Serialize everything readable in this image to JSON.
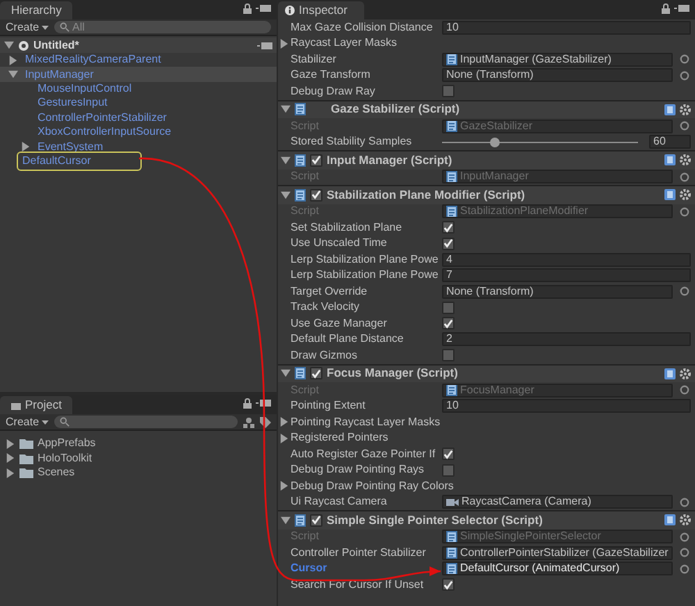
{
  "hierarchy": {
    "title": "Hierarchy",
    "create": "Create",
    "search_placeholder": "All",
    "scene": {
      "name": "Untitled*",
      "expanded": true
    },
    "items": [
      {
        "label": "MixedRealityCameraParent",
        "expanded": false,
        "selected": false,
        "highlighted": false
      },
      {
        "label": "InputManager",
        "expanded": true,
        "selected": true,
        "highlighted": false,
        "children": [
          {
            "label": "MouseInputControl",
            "selected": false,
            "highlighted": false
          },
          {
            "label": "GesturesInput",
            "selected": false,
            "highlighted": false
          },
          {
            "label": "ControllerPointerStabilizer",
            "selected": false,
            "highlighted": false
          },
          {
            "label": "XboxControllerInputSource",
            "selected": false,
            "highlighted": false
          },
          {
            "label": "EventSystem",
            "expanded": false,
            "selected": false,
            "highlighted": false
          }
        ]
      },
      {
        "label": "DefaultCursor",
        "selected": false,
        "highlighted": true
      }
    ]
  },
  "project": {
    "title": "Project",
    "create": "Create",
    "folders": [
      {
        "label": "AppPrefabs",
        "expanded": false
      },
      {
        "label": "HoloToolkit",
        "expanded": false
      },
      {
        "label": "Scenes",
        "expanded": false
      }
    ]
  },
  "inspector": {
    "title": "Inspector",
    "rows": [
      {
        "kind": "number",
        "label": "Max Gaze Collision Distance",
        "value": "10"
      },
      {
        "kind": "foldout",
        "label": "Raycast Layer Masks",
        "expanded": false
      },
      {
        "kind": "object",
        "label": "Stabilizer",
        "value": "InputManager (GazeStabilizer)"
      },
      {
        "kind": "empty_object",
        "label": "Gaze Transform",
        "value": "None (Transform)"
      },
      {
        "kind": "toggle",
        "label": "Debug Draw Ray",
        "checked": false
      }
    ],
    "components": [
      {
        "title": "Gaze Stabilizer (Script)",
        "expanded": true,
        "rows": [
          {
            "kind": "script",
            "label": "Script",
            "value": "GazeStabilizer",
            "disabled": true
          },
          {
            "kind": "slider",
            "label": "Stored Stability Samples",
            "level": 0.27,
            "value": "60"
          }
        ]
      },
      {
        "title": "Input Manager (Script)",
        "expanded": true,
        "enabled": true,
        "rows": [
          {
            "kind": "script",
            "label": "Script",
            "value": "InputManager",
            "disabled": true
          }
        ]
      },
      {
        "title": "Stabilization Plane Modifier (Script)",
        "expanded": true,
        "enabled": true,
        "rows": [
          {
            "kind": "script",
            "label": "Script",
            "value": "StabilizationPlaneModifier",
            "disabled": true
          },
          {
            "kind": "toggle",
            "label": "Set Stabilization Plane",
            "checked": true
          },
          {
            "kind": "toggle",
            "label": "Use Unscaled Time",
            "checked": true
          },
          {
            "kind": "number",
            "label": "Lerp Stabilization Plane Powe",
            "value": "4"
          },
          {
            "kind": "number",
            "label": "Lerp Stabilization Plane Powe",
            "value": "7"
          },
          {
            "kind": "empty_object",
            "label": "Target Override",
            "value": "None (Transform)"
          },
          {
            "kind": "toggle",
            "label": "Track Velocity",
            "checked": false
          },
          {
            "kind": "toggle",
            "label": "Use Gaze Manager",
            "checked": true
          },
          {
            "kind": "number",
            "label": "Default Plane Distance",
            "value": "2"
          },
          {
            "kind": "toggle",
            "label": "Draw Gizmos",
            "checked": false
          }
        ]
      },
      {
        "title": "Focus Manager (Script)",
        "expanded": true,
        "enabled": true,
        "rows": [
          {
            "kind": "script",
            "label": "Script",
            "value": "FocusManager",
            "disabled": true
          },
          {
            "kind": "number",
            "label": "Pointing Extent",
            "value": "10"
          },
          {
            "kind": "foldout",
            "label": "Pointing Raycast Layer Masks",
            "expanded": false
          },
          {
            "kind": "foldout",
            "label": "Registered Pointers",
            "expanded": false
          },
          {
            "kind": "toggle",
            "label": "Auto Register Gaze Pointer If",
            "checked": true
          },
          {
            "kind": "toggle",
            "label": "Debug Draw Pointing Rays",
            "checked": false
          },
          {
            "kind": "foldout",
            "label": "Debug Draw Pointing Ray Colors",
            "expanded": false
          },
          {
            "kind": "camera_object",
            "label": "Ui Raycast Camera",
            "value": "RaycastCamera (Camera)"
          }
        ]
      },
      {
        "title": "Simple Single Pointer Selector (Script)",
        "expanded": true,
        "enabled": true,
        "rows": [
          {
            "kind": "script",
            "label": "Script",
            "value": "SimpleSinglePointerSelector",
            "disabled": true
          },
          {
            "kind": "object",
            "label": "Controller Pointer Stabilizer",
            "value": "ControllerPointerStabilizer (GazeStabilizer"
          },
          {
            "kind": "object",
            "label": "Cursor",
            "value": "DefaultCursor (AnimatedCursor)",
            "modified": true,
            "focused": true
          },
          {
            "kind": "toggle",
            "label": "Search For Cursor If Unset",
            "checked": true
          }
        ]
      }
    ]
  }
}
